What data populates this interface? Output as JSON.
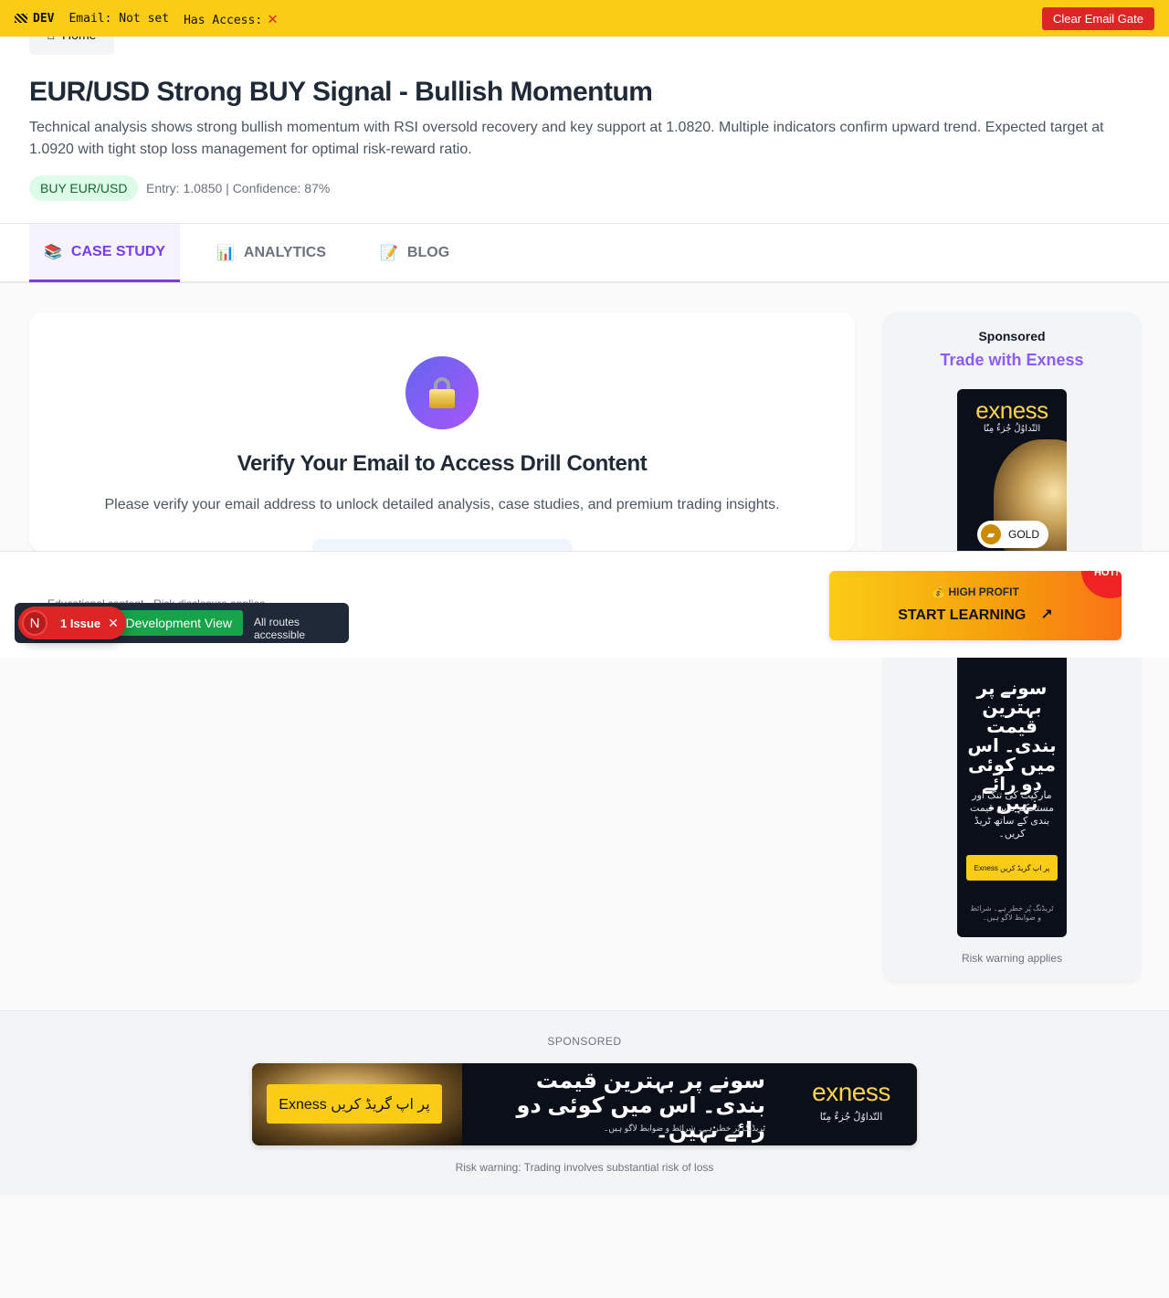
{
  "devbar": {
    "tag": "DEV",
    "email_label": "Email: Not set",
    "access_label": "Has Access:",
    "access_icon": "✕",
    "clear_button": "Clear Email Gate"
  },
  "header": {
    "home_label": "Home",
    "home_icon": "home-icon",
    "title": "EUR/USD Strong BUY Signal - Bullish Momentum",
    "description": "Technical analysis shows strong bullish momentum with RSI oversold recovery and key support at 1.0820. Multiple indicators confirm upward trend. Expected target at 1.0920 with tight stop loss management for optimal risk-reward ratio.",
    "signal_badge": "BUY EUR/USD",
    "signal_meta": "Entry: 1.0850 | Confidence: 87%"
  },
  "tabs": [
    {
      "icon": "📚",
      "label": "CASE STUDY",
      "active": true
    },
    {
      "icon": "📊",
      "label": "ANALYTICS",
      "active": false
    },
    {
      "icon": "📝",
      "label": "BLOG",
      "active": false
    }
  ],
  "gate": {
    "title": "Verify Your Email to Access Drill Content",
    "text": "Please verify your email address to unlock detailed analysis, case studies, and premium trading insights."
  },
  "side_ad": {
    "sponsored": "Sponsored",
    "heading": "Trade with Exness",
    "logo": "exness",
    "tagline": "التّداوُلُ جُزءٌ مِنّا",
    "gold_label": "GOLD",
    "headline": "سونے پر بہترین قیمت بندی۔ اس میں کوئی دو رائے نہیں۔",
    "subtext": "مارکیٹ کی تنگ اور مستحکم ترین قیمت بندی کے ساتھ ٹریڈ کریں۔",
    "button": "Exness پر اپ گریڈ کریں",
    "risk_small": "ٹریڈنگ پُر خطر ہے۔ شرائط و ضوابط لاگو ہیں۔",
    "risk": "Risk warning applies"
  },
  "sticky": {
    "disclaimer": "Educational content - Risk disclosure applies",
    "cta_top": "💰 HIGH PROFIT",
    "cta_main": "START LEARNING",
    "cta_arrow": "↗",
    "hot": "HOT!"
  },
  "dev_toolbar": {
    "view_label": "Development View",
    "routes_label": "All routes accessible",
    "issue_label": "1 Issue",
    "n_label": "N",
    "close": "✕"
  },
  "bottom": {
    "label": "SPONSORED",
    "button": "Exness پر اپ گریڈ کریں",
    "headline": "سونے پر بہترین قیمت بندی۔ اس میں کوئی دو رائے نہیں۔",
    "risk_small": "ٹریڈنگ پُر خطر ہے۔ شرائط و ضوابط لاگو ہیں۔",
    "logo": "exness",
    "tagline": "التّداوُلُ جُزءٌ مِنّا",
    "risk": "Risk warning: Trading involves substantial risk of loss"
  },
  "colors": {
    "devbar": "#facc15",
    "accent": "#7c3aed",
    "success": "#16a34a",
    "danger": "#dc2626",
    "brand_gold": "#fcd34d"
  }
}
